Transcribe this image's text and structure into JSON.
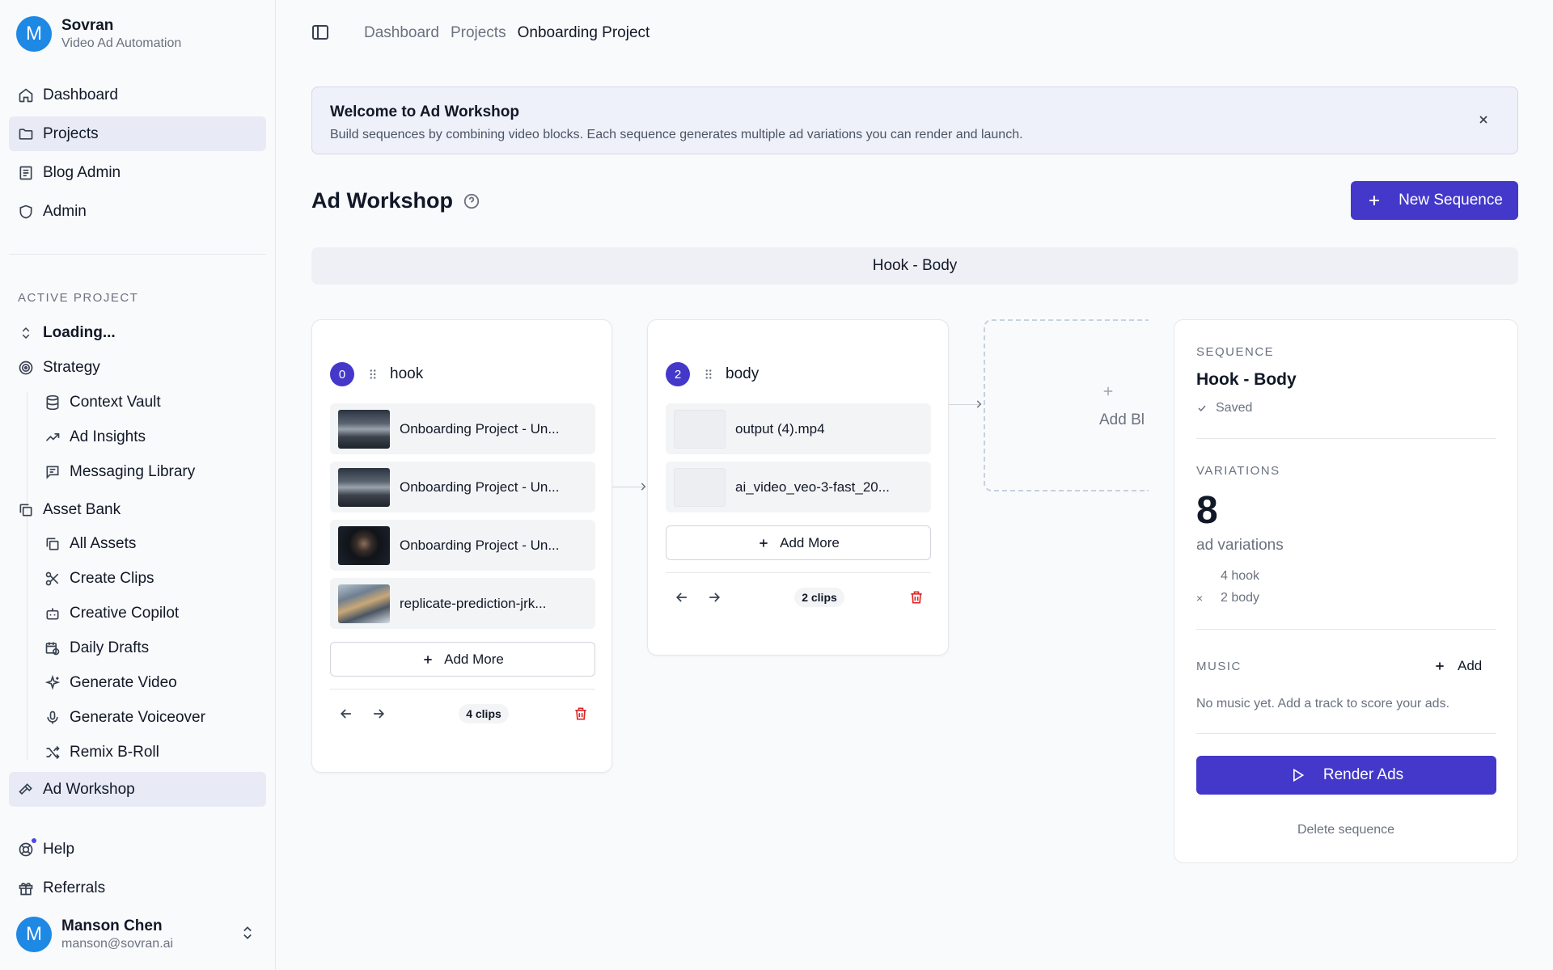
{
  "brand": {
    "initial": "M",
    "name": "Sovran",
    "subtitle": "Video Ad Automation"
  },
  "nav": {
    "top": [
      {
        "label": "Dashboard",
        "icon": "home-icon"
      },
      {
        "label": "Projects",
        "icon": "folder-icon",
        "active": true
      },
      {
        "label": "Blog Admin",
        "icon": "newspaper-icon"
      },
      {
        "label": "Admin",
        "icon": "shield-icon"
      }
    ],
    "section_label": "ACTIVE PROJECT",
    "project_selector": "Loading...",
    "strategy": "Strategy",
    "strategy_items": [
      "Context Vault",
      "Ad Insights",
      "Messaging Library"
    ],
    "asset_bank": "Asset Bank",
    "asset_items": [
      "All Assets",
      "Create Clips",
      "Creative Copilot",
      "Daily Drafts",
      "Generate Video",
      "Generate Voiceover",
      "Remix B-Roll"
    ],
    "ad_workshop": "Ad Workshop",
    "help": "Help",
    "referrals": "Referrals"
  },
  "user": {
    "initial": "M",
    "name": "Manson Chen",
    "email": "manson@sovran.ai"
  },
  "breadcrumb": [
    "Dashboard",
    "Projects",
    "Onboarding Project"
  ],
  "welcome": {
    "title": "Welcome to Ad Workshop",
    "body": "Build sequences by combining video blocks. Each sequence generates multiple ad variations you can render and launch."
  },
  "page": {
    "title": "Ad Workshop",
    "new_sequence_label": "New Sequence"
  },
  "sequence_tab": "Hook - Body",
  "blocks": [
    {
      "index": "0",
      "name": "hook",
      "clips": [
        {
          "name": "Onboarding Project - Un...",
          "thumb": "mountain"
        },
        {
          "name": "Onboarding Project - Un...",
          "thumb": "mountain"
        },
        {
          "name": "Onboarding Project - Un...",
          "thumb": "person"
        },
        {
          "name": "replicate-prediction-jrk...",
          "thumb": "rocks"
        }
      ],
      "add_more": "Add More",
      "clip_count": "4 clips"
    },
    {
      "index": "2",
      "name": "body",
      "clips": [
        {
          "name": "output (4).mp4",
          "thumb": "blank"
        },
        {
          "name": "ai_video_veo-3-fast_20...",
          "thumb": "blank"
        }
      ],
      "add_more": "Add More",
      "clip_count": "2 clips"
    }
  ],
  "add_block_label": "Add Bl",
  "panel": {
    "sequence_label": "SEQUENCE",
    "sequence_title": "Hook - Body",
    "saved": "Saved",
    "variations_label": "VARIATIONS",
    "variations_count": "8",
    "variations_unit": "ad variations",
    "breakdown": [
      {
        "mult": "",
        "text": "4 hook"
      },
      {
        "mult": "×",
        "text": "2 body"
      }
    ],
    "music_label": "MUSIC",
    "music_add": "Add",
    "music_empty": "No music yet. Add a track to score your ads.",
    "render_label": "Render Ads",
    "delete_label": "Delete sequence"
  },
  "colors": {
    "accent": "#4338ca",
    "danger": "#dc2626",
    "avatar": "#1e88e5"
  }
}
